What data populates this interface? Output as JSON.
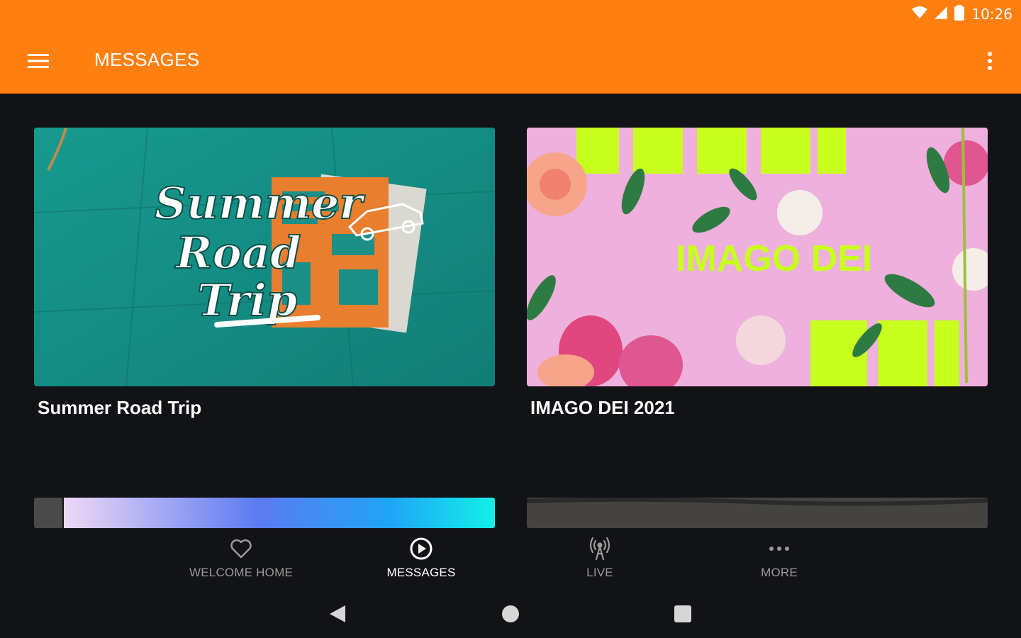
{
  "status_bar": {
    "time": "10:26",
    "icons": [
      "wifi-icon",
      "cell-signal-icon",
      "battery-icon"
    ]
  },
  "app_bar": {
    "title": "MESSAGES",
    "menu_icon": "hamburger-menu-icon",
    "overflow_icon": "more-vert-icon",
    "background": "#FF7F11"
  },
  "cards": [
    {
      "title": "Summer Road Trip",
      "artwork_text": [
        "Summer",
        "Road",
        "Trip"
      ],
      "artwork_bg": "#168E85"
    },
    {
      "title": "IMAGO DEI 2021",
      "artwork_text": "IMAGO DEI",
      "artwork_bg": "#EEB0DC",
      "accent": "#C8FF1E"
    }
  ],
  "bottom_nav": {
    "items": [
      {
        "label": "WELCOME HOME",
        "icon": "heart-icon",
        "active": false
      },
      {
        "label": "MESSAGES",
        "icon": "play-circle-icon",
        "active": true
      },
      {
        "label": "LIVE",
        "icon": "broadcast-antenna-icon",
        "active": false
      },
      {
        "label": "MORE",
        "icon": "more-horiz-icon",
        "active": false
      }
    ]
  },
  "system_nav": {
    "icons": [
      "back-triangle-icon",
      "home-circle-icon",
      "recents-square-icon"
    ]
  }
}
